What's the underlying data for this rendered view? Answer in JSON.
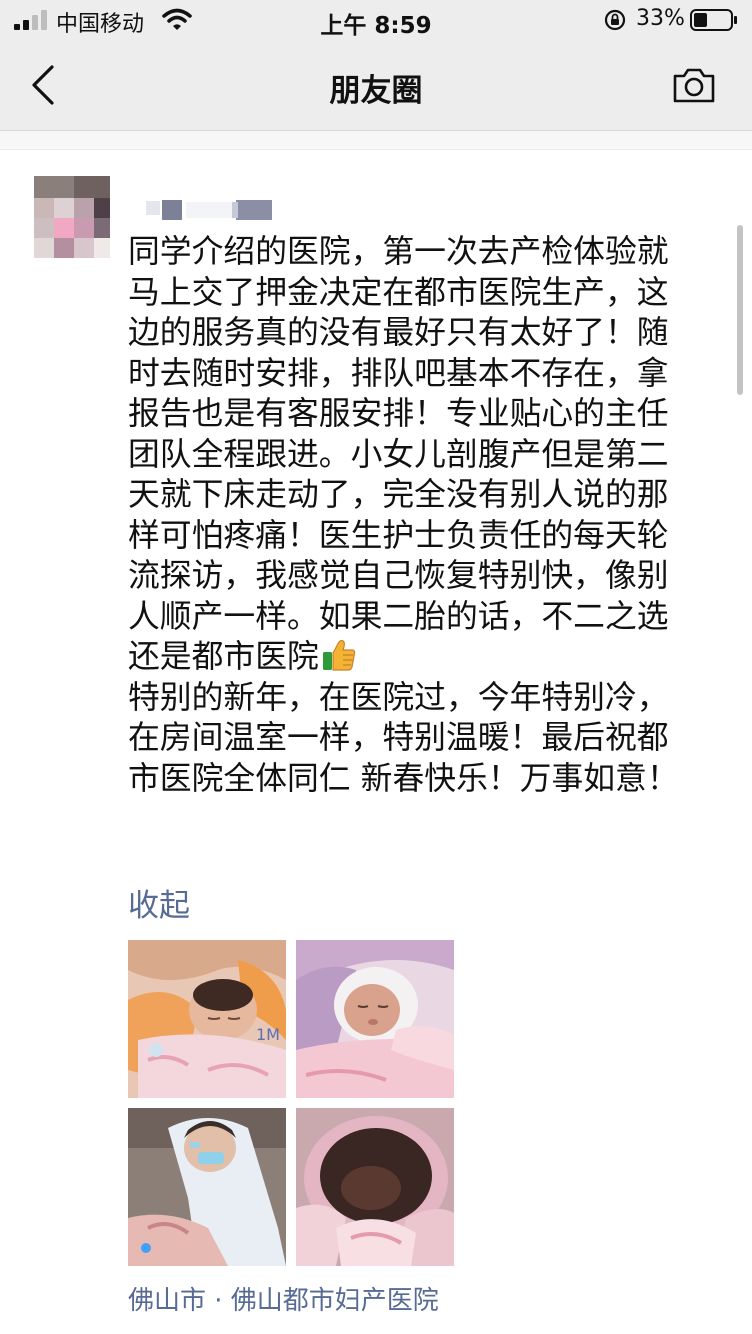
{
  "status_bar": {
    "carrier": "中国移动",
    "time": "上午 8:59",
    "battery": "33%"
  },
  "nav": {
    "title": "朋友圈",
    "back_icon": "chevron-left-icon",
    "camera_icon": "camera-icon"
  },
  "post": {
    "lines": [
      "同学介绍的医院，第一次去产检体验就",
      "马上交了押金决定在都市医院生产，这",
      "边的服务真的没有最好只有太好了！随",
      "时去随时安排，排队吧基本不存在，拿",
      "报告也是有客服安排！专业贴心的主任",
      "团队全程跟进。小女儿剖腹产但是第二",
      "天就下床走动了，完全没有别人说的那",
      "样可怕疼痛！医生护士负责任的每天轮",
      "流探访，我感觉自己恢复特别快，像别",
      "人顺产一样。如果二胎的话，不二之选",
      "还是都市医院",
      "特别的新年，在医院过，今年特别冷，",
      "在房间温室一样，特别温暖！最后祝都",
      "市医院全体同仁 新春快乐！万事如意！"
    ],
    "emoji": "thumbs-up-icon",
    "collapse_label": "收起",
    "photos": [
      "newborn-photo-1",
      "newborn-photo-2",
      "doctor-photo",
      "bassinet-photo"
    ],
    "location": "佛山市 · 佛山都市妇产医院"
  },
  "colors": {
    "bar_bg": "#ededed",
    "link": "#576b95",
    "text": "#111111"
  }
}
